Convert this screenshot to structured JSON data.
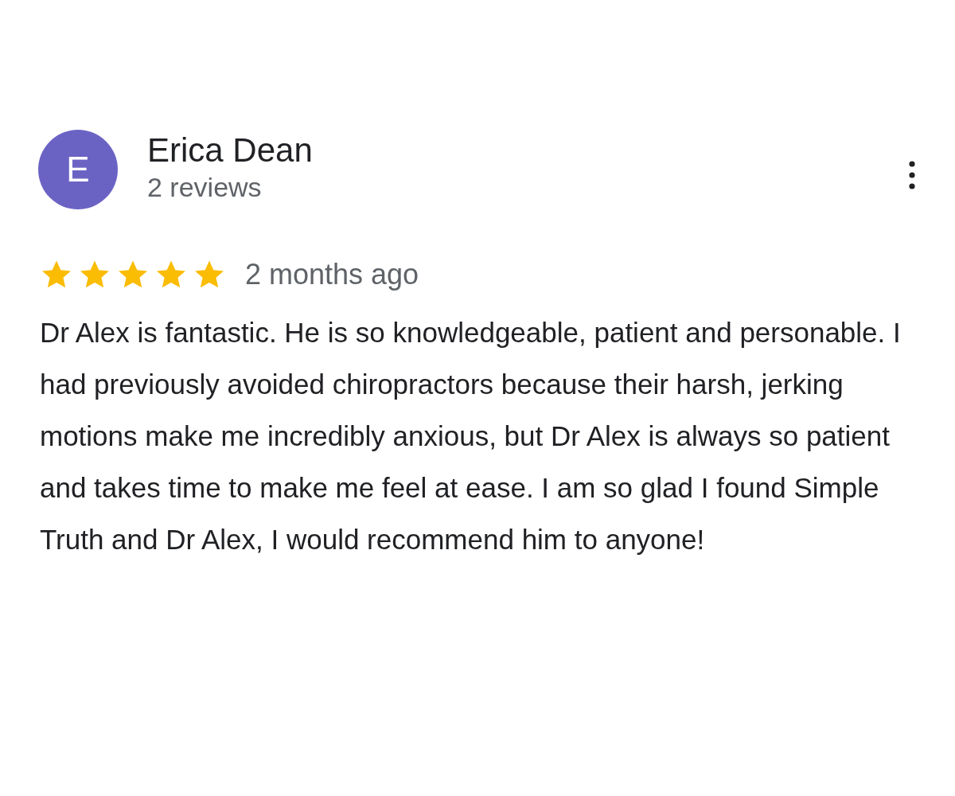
{
  "review": {
    "author": {
      "initial": "E",
      "name": "Erica Dean",
      "reviews": "2 reviews"
    },
    "stars": 5,
    "time": "2 months ago",
    "text": "Dr Alex is fantastic. He is so knowledgeable, patient and personable. I had previously avoided chiropractors because their harsh, jerking motions make me incredibly anxious, but Dr Alex is always so patient and takes time to make me feel at ease. I am so glad I found Simple Truth and Dr Alex, I would recommend him to anyone!"
  }
}
